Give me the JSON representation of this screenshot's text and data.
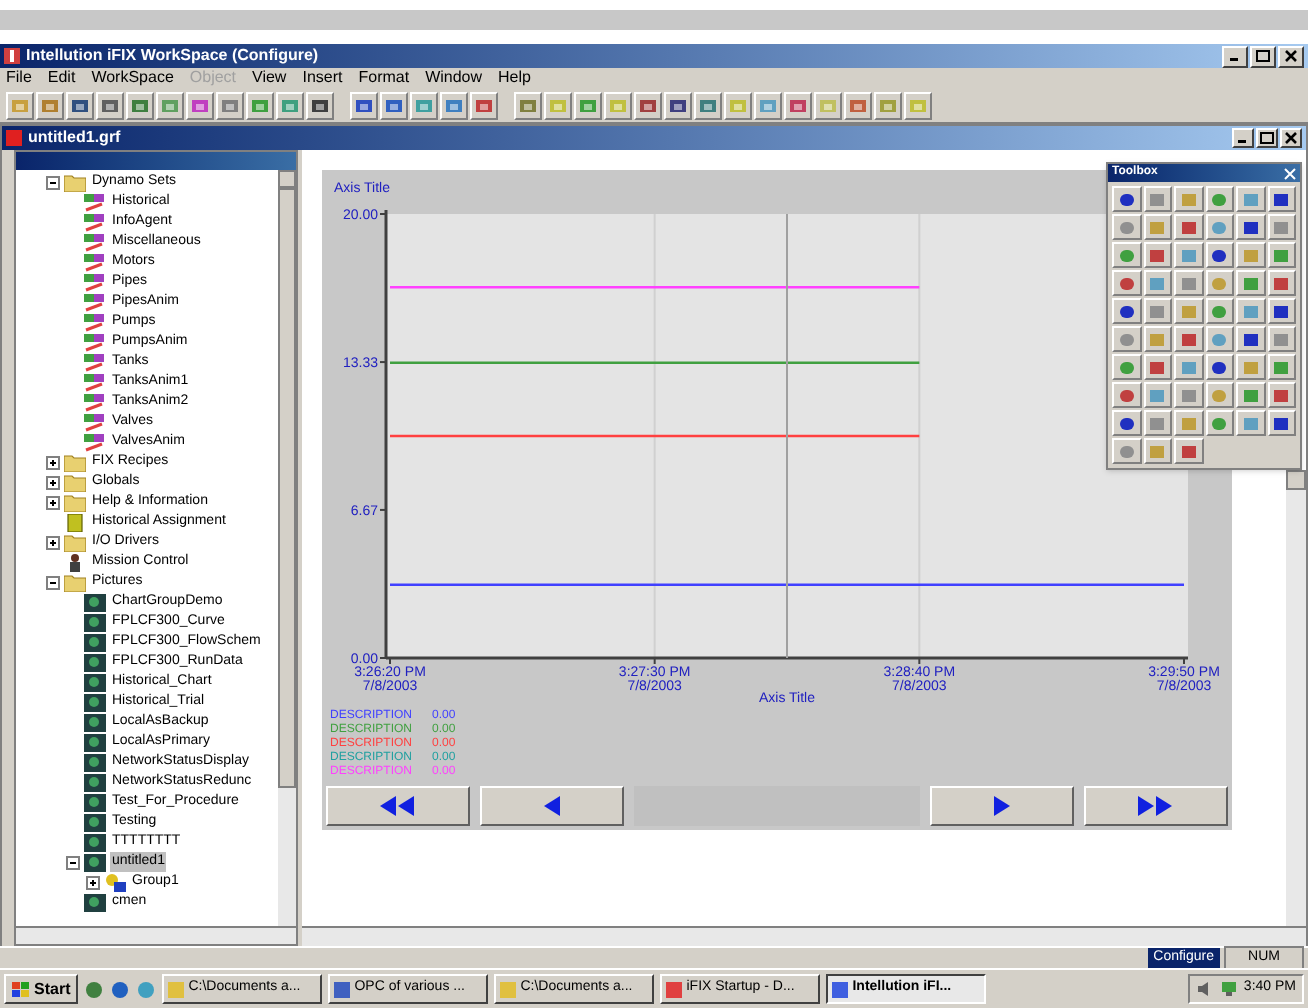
{
  "window": {
    "title": "Intellution iFIX WorkSpace (Configure)"
  },
  "menu": [
    {
      "label": "File",
      "disabled": false
    },
    {
      "label": "Edit",
      "disabled": false
    },
    {
      "label": "WorkSpace",
      "disabled": false
    },
    {
      "label": "Object",
      "disabled": true
    },
    {
      "label": "View",
      "disabled": false
    },
    {
      "label": "Insert",
      "disabled": false
    },
    {
      "label": "Format",
      "disabled": false
    },
    {
      "label": "Window",
      "disabled": false
    },
    {
      "label": "Help",
      "disabled": false
    }
  ],
  "document": {
    "title": "untitled1.grf"
  },
  "tree": [
    {
      "label": "Dynamo Sets",
      "kind": "folder",
      "expanded": true,
      "selected": false,
      "children": [
        {
          "label": "Historical",
          "kind": "dynamo",
          "selected": false
        },
        {
          "label": "InfoAgent",
          "kind": "dynamo",
          "selected": false
        },
        {
          "label": "Miscellaneous",
          "kind": "dynamo",
          "selected": false
        },
        {
          "label": "Motors",
          "kind": "dynamo",
          "selected": false
        },
        {
          "label": "Pipes",
          "kind": "dynamo",
          "selected": false
        },
        {
          "label": "PipesAnim",
          "kind": "dynamo",
          "selected": false
        },
        {
          "label": "Pumps",
          "kind": "dynamo",
          "selected": false
        },
        {
          "label": "PumpsAnim",
          "kind": "dynamo",
          "selected": false
        },
        {
          "label": "Tanks",
          "kind": "dynamo",
          "selected": false
        },
        {
          "label": "TanksAnim1",
          "kind": "dynamo",
          "selected": false
        },
        {
          "label": "TanksAnim2",
          "kind": "dynamo",
          "selected": false
        },
        {
          "label": "Valves",
          "kind": "dynamo",
          "selected": false
        },
        {
          "label": "ValvesAnim",
          "kind": "dynamo",
          "selected": false
        }
      ]
    },
    {
      "label": "FIX Recipes",
      "kind": "folder",
      "expanded": false,
      "selected": false
    },
    {
      "label": "Globals",
      "kind": "folder",
      "expanded": false,
      "selected": false
    },
    {
      "label": "Help & Information",
      "kind": "folder",
      "expanded": false,
      "selected": false
    },
    {
      "label": "Historical Assignment",
      "kind": "assignment",
      "selected": false
    },
    {
      "label": "I/O Drivers",
      "kind": "folder",
      "expanded": false,
      "selected": false
    },
    {
      "label": "Mission Control",
      "kind": "mission",
      "selected": false
    },
    {
      "label": "Pictures",
      "kind": "folder",
      "expanded": true,
      "selected": false,
      "children": [
        {
          "label": "ChartGroupDemo",
          "kind": "picture",
          "selected": false
        },
        {
          "label": "FPLCF300_Curve",
          "kind": "picture",
          "selected": false
        },
        {
          "label": "FPLCF300_FlowSchem",
          "kind": "picture",
          "selected": false
        },
        {
          "label": "FPLCF300_RunData",
          "kind": "picture",
          "selected": false
        },
        {
          "label": "Historical_Chart",
          "kind": "picture",
          "selected": false
        },
        {
          "label": "Historical_Trial",
          "kind": "picture",
          "selected": false
        },
        {
          "label": "LocalAsBackup",
          "kind": "picture",
          "selected": false
        },
        {
          "label": "LocalAsPrimary",
          "kind": "picture",
          "selected": false
        },
        {
          "label": "NetworkStatusDisplay",
          "kind": "picture",
          "selected": false
        },
        {
          "label": "NetworkStatusRedunc",
          "kind": "picture",
          "selected": false
        },
        {
          "label": "Test_For_Procedure",
          "kind": "picture",
          "selected": false
        },
        {
          "label": "Testing",
          "kind": "picture",
          "selected": false
        },
        {
          "label": "TTTTTTTT",
          "kind": "picture",
          "selected": false
        },
        {
          "label": "untitled1",
          "kind": "picture",
          "expanded": true,
          "selected": true,
          "children": [
            {
              "label": "Group1",
              "kind": "group",
              "expanded": false,
              "selected": false
            }
          ]
        },
        {
          "label": "cmen",
          "kind": "picture",
          "selected": false
        }
      ]
    }
  ],
  "chart": {
    "chart_data": {
      "type": "line",
      "xlabel": "Axis Title",
      "ylabel": "Axis Title",
      "categories": [
        "3:26:20 PM",
        "3:27:30 PM",
        "3:28:40 PM",
        "3:29:50 PM"
      ],
      "series": [
        {
          "name": "DESCRIPTION",
          "color": "#4040ff",
          "values": [
            3.3,
            3.3,
            3.3,
            3.3
          ]
        },
        {
          "name": "DESCRIPTION",
          "color": "#40a040",
          "values": [
            13.3,
            13.3,
            13.3,
            null
          ]
        },
        {
          "name": "DESCRIPTION",
          "color": "#ff4040",
          "values": [
            10,
            10,
            10,
            null
          ]
        },
        {
          "name": "DESCRIPTION",
          "color": "#20a0a0",
          "values": [
            null,
            null,
            null,
            null
          ]
        },
        {
          "name": "DESCRIPTION",
          "color": "#ff40ff",
          "values": [
            16.7,
            16.7,
            16.7,
            null
          ]
        }
      ],
      "ylim": [
        0,
        20
      ],
      "yticks": [
        {
          "value": 0,
          "label": "0.00"
        },
        {
          "value": 6.67,
          "label": "6.67"
        },
        {
          "value": 13.33,
          "label": "13.33"
        },
        {
          "value": 20,
          "label": "20.00"
        }
      ]
    },
    "xtick_dates": [
      "7/8/2003",
      "7/8/2003",
      "7/8/2003",
      "7/8/2003"
    ],
    "legend_values": [
      "0.00",
      "0.00",
      "0.00",
      "0.00",
      "0.00"
    ]
  },
  "toolbox": {
    "title": "Toolbox"
  },
  "status_bar": {
    "mode": "Configure",
    "num": "NUM"
  },
  "taskbar": {
    "start": "Start",
    "tasks": [
      {
        "label": "C:\\Documents a...",
        "selected": false
      },
      {
        "label": "OPC of various ...",
        "selected": false
      },
      {
        "label": "C:\\Documents a...",
        "selected": false
      },
      {
        "label": "iFIX Startup - D...",
        "selected": false
      },
      {
        "label": "Intellution iFI...",
        "selected": true
      }
    ],
    "clock": "3:40 PM"
  }
}
